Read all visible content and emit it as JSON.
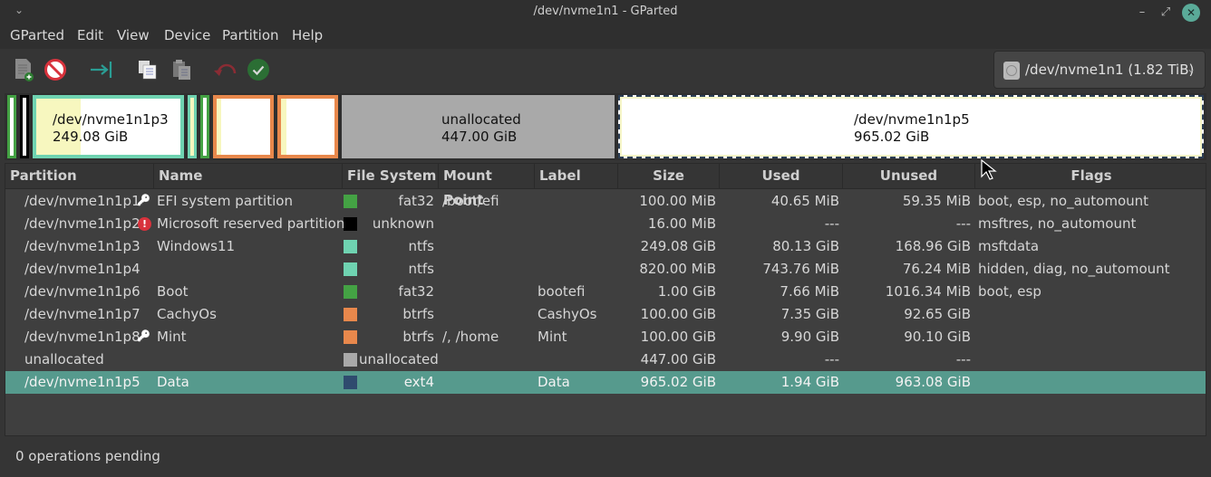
{
  "window": {
    "title": "/dev/nvme1n1 - GParted",
    "menu_icon": "chevron-down-icon",
    "min_icon": "minimize-icon",
    "max_icon": "maximize-icon",
    "close_icon": "close-icon"
  },
  "menubar": [
    "GParted",
    "Edit",
    "View",
    "Device",
    "Partition",
    "Help"
  ],
  "toolbar": {
    "buttons": [
      {
        "name": "new-partition",
        "icon": "new-document-icon",
        "enabled": false
      },
      {
        "name": "delete-partition",
        "icon": "no-entry-icon",
        "enabled": true
      },
      {
        "name": "resize-move",
        "icon": "resize-arrow-icon",
        "enabled": true
      },
      {
        "name": "copy",
        "icon": "copy-icon",
        "enabled": true
      },
      {
        "name": "paste",
        "icon": "paste-icon",
        "enabled": false
      },
      {
        "name": "undo",
        "icon": "undo-icon",
        "enabled": false
      },
      {
        "name": "apply",
        "icon": "check-circle-icon",
        "enabled": true
      }
    ]
  },
  "device_selector": {
    "value": "/dev/nvme1n1 (1.82 TiB)",
    "icon": "disk-icon"
  },
  "colors": {
    "fat32": "#44a244",
    "unknown": "#000000",
    "ntfs": "#6fd3b1",
    "btrfs": "#e8884c",
    "unallocated": "#a9a9a9",
    "ext4": "#2f4b6e",
    "used": "#f7f7bf",
    "selected_row": "#569a8d"
  },
  "diskmap": {
    "p3": {
      "label": "/dev/nvme1n1p3",
      "size": "249.08 GiB"
    },
    "unallocated": {
      "label": "unallocated",
      "size": "447.00 GiB"
    },
    "p5": {
      "label": "/dev/nvme1n1p5",
      "size": "965.02 GiB"
    }
  },
  "table": {
    "columns": [
      "Partition",
      "Name",
      "File System",
      "Mount Point",
      "Label",
      "Size",
      "Used",
      "Unused",
      "Flags"
    ],
    "rows": [
      {
        "partition": "/dev/nvme1n1p1",
        "icon": "key-icon",
        "name": "EFI system partition",
        "fs": "fat32",
        "fs_color": "#44a244",
        "mount": "/boot/efi",
        "label": "",
        "size": "100.00 MiB",
        "used": "40.65 MiB",
        "unused": "59.35 MiB",
        "flags": "boot, esp, no_automount"
      },
      {
        "partition": "/dev/nvme1n1p2",
        "icon": "warning-icon",
        "name": "Microsoft reserved partition",
        "fs": "unknown",
        "fs_color": "#000000",
        "mount": "",
        "label": "",
        "size": "16.00 MiB",
        "used": "---",
        "unused": "---",
        "flags": "msftres, no_automount"
      },
      {
        "partition": "/dev/nvme1n1p3",
        "icon": "",
        "name": "Windows11",
        "fs": "ntfs",
        "fs_color": "#6fd3b1",
        "mount": "",
        "label": "",
        "size": "249.08 GiB",
        "used": "80.13 GiB",
        "unused": "168.96 GiB",
        "flags": "msftdata"
      },
      {
        "partition": "/dev/nvme1n1p4",
        "icon": "",
        "name": "",
        "fs": "ntfs",
        "fs_color": "#6fd3b1",
        "mount": "",
        "label": "",
        "size": "820.00 MiB",
        "used": "743.76 MiB",
        "unused": "76.24 MiB",
        "flags": "hidden, diag, no_automount"
      },
      {
        "partition": "/dev/nvme1n1p6",
        "icon": "",
        "name": "Boot",
        "fs": "fat32",
        "fs_color": "#44a244",
        "mount": "",
        "label": "bootefi",
        "size": "1.00 GiB",
        "used": "7.66 MiB",
        "unused": "1016.34 MiB",
        "flags": "boot, esp"
      },
      {
        "partition": "/dev/nvme1n1p7",
        "icon": "",
        "name": "CachyOs",
        "fs": "btrfs",
        "fs_color": "#e8884c",
        "mount": "",
        "label": "CashyOs",
        "size": "100.00 GiB",
        "used": "7.35 GiB",
        "unused": "92.65 GiB",
        "flags": ""
      },
      {
        "partition": "/dev/nvme1n1p8",
        "icon": "key-icon",
        "name": "Mint",
        "fs": "btrfs",
        "fs_color": "#e8884c",
        "mount": "/, /home",
        "label": "Mint",
        "size": "100.00 GiB",
        "used": "9.90 GiB",
        "unused": "90.10 GiB",
        "flags": ""
      },
      {
        "partition": "unallocated",
        "icon": "",
        "name": "",
        "fs": "unallocated",
        "fs_color": "#a9a9a9",
        "mount": "",
        "label": "",
        "size": "447.00 GiB",
        "used": "---",
        "unused": "---",
        "flags": ""
      },
      {
        "partition": "/dev/nvme1n1p5",
        "icon": "",
        "name": "Data",
        "fs": "ext4",
        "fs_color": "#2f4b6e",
        "mount": "",
        "label": "Data",
        "size": "965.02 GiB",
        "used": "1.94 GiB",
        "unused": "963.08 GiB",
        "flags": "",
        "selected": true
      }
    ]
  },
  "status": "0 operations pending"
}
